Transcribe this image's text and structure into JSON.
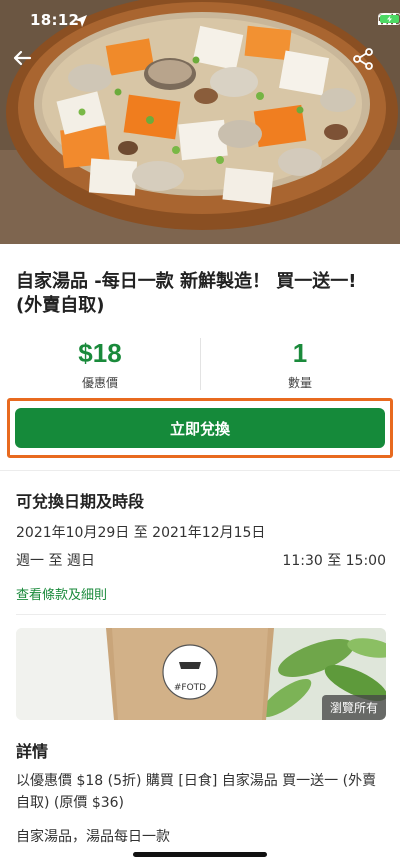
{
  "status_bar": {
    "time": "18:12"
  },
  "hero": {
    "back_icon": "back-arrow-icon",
    "share_icon": "share-icon"
  },
  "product": {
    "title": "自家湯品 -每日一款 新鮮製造！ 買一送一! (外賣自取)"
  },
  "stats": {
    "price_value": "$18",
    "price_label": "優惠價",
    "quantity_value": "1",
    "quantity_label": "數量"
  },
  "actions": {
    "redeem_label": "立即兌換"
  },
  "period": {
    "heading": "可兌換日期及時段",
    "dates": "2021年10月29日 至 2021年12月15日",
    "days": "週一 至 週日",
    "time": "11:30 至 15:00",
    "terms_link": "查看條款及細則"
  },
  "gallery": {
    "browse_label": "瀏覽所有",
    "cup_logo_text": "#FOTD"
  },
  "details": {
    "heading": "詳情",
    "body": "以優惠價 $18 (5折) 購買 [日食] 自家湯品 買一送一 (外賣自取) (原價 $36)",
    "subtext": "自家湯品，湯品每日一款"
  },
  "colors": {
    "accent_green": "#158a3a",
    "highlight_orange": "#e86a1f"
  }
}
